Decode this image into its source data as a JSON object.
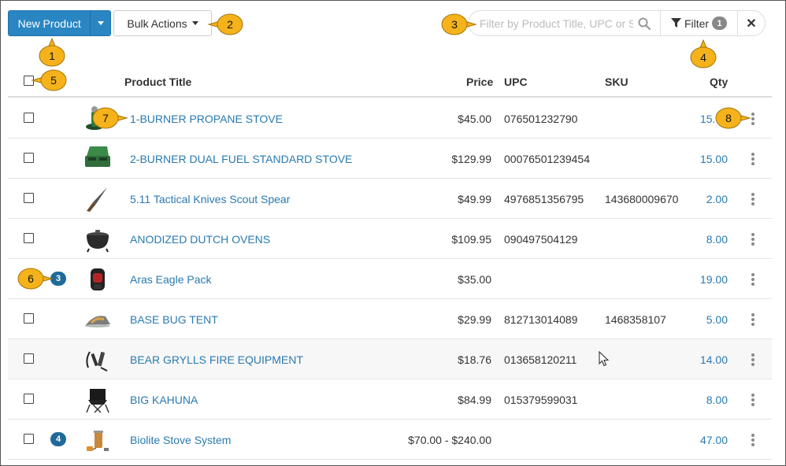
{
  "toolbar": {
    "new_product_label": "New Product",
    "bulk_actions_label": "Bulk Actions",
    "search_placeholder": "Filter by Product Title, UPC or SKU",
    "filter_label": "Filter",
    "filter_count": "1",
    "clear_label": "✕"
  },
  "columns": {
    "title": "Product Title",
    "price": "Price",
    "upc": "UPC",
    "sku": "SKU",
    "qty": "Qty"
  },
  "rows": [
    {
      "title": "1-BURNER PROPANE STOVE",
      "price": "$45.00",
      "upc": "076501232790",
      "sku": "",
      "qty": "15.00",
      "badge": "",
      "thumb": "stove-1-icon"
    },
    {
      "title": "2-BURNER DUAL FUEL STANDARD STOVE",
      "price": "$129.99",
      "upc": "00076501239454",
      "sku": "",
      "qty": "15.00",
      "badge": "",
      "thumb": "stove-2-icon"
    },
    {
      "title": "5.11 Tactical Knives Scout Spear",
      "price": "$49.99",
      "upc": "4976851356795",
      "sku": "143680009670",
      "qty": "2.00",
      "badge": "",
      "thumb": "knife-icon"
    },
    {
      "title": "ANODIZED DUTCH OVENS",
      "price": "$109.95",
      "upc": "090497504129",
      "sku": "",
      "qty": "8.00",
      "badge": "",
      "thumb": "dutch-oven-icon"
    },
    {
      "title": "Aras Eagle Pack",
      "price": "$35.00",
      "upc": "",
      "sku": "",
      "qty": "19.00",
      "badge": "3",
      "thumb": "backpack-icon"
    },
    {
      "title": "BASE BUG TENT",
      "price": "$29.99",
      "upc": "812713014089",
      "sku": "1468358107",
      "qty": "5.00",
      "badge": "",
      "thumb": "tent-icon"
    },
    {
      "title": "BEAR GRYLLS FIRE EQUIPMENT",
      "price": "$18.76",
      "upc": "013658120211",
      "sku": "",
      "qty": "14.00",
      "badge": "",
      "thumb": "fire-starter-icon"
    },
    {
      "title": "BIG KAHUNA",
      "price": "$84.99",
      "upc": "015379599031",
      "sku": "",
      "qty": "8.00",
      "badge": "",
      "thumb": "camp-chair-icon"
    },
    {
      "title": "Biolite Stove System",
      "price": "$70.00 - $240.00",
      "upc": "",
      "sku": "",
      "qty": "47.00",
      "badge": "4",
      "thumb": "biolite-stove-icon"
    }
  ],
  "callouts": [
    "1",
    "2",
    "3",
    "4",
    "5",
    "6",
    "7",
    "8"
  ],
  "colors": {
    "primary": "#2a86c2",
    "link": "#2a7ab0",
    "badge": "#1f6a9a",
    "callout": "#f5b21b"
  }
}
